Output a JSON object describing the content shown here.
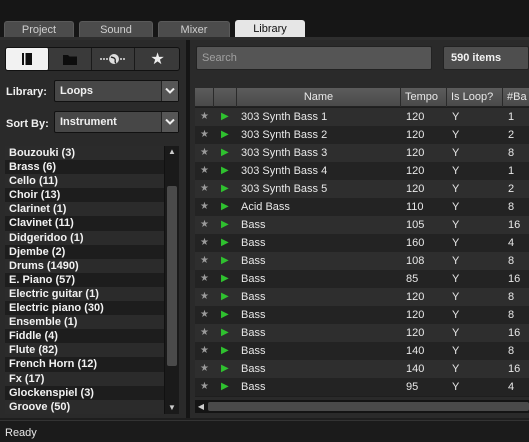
{
  "tabs": [
    {
      "label": "Project",
      "active": false
    },
    {
      "label": "Sound",
      "active": false
    },
    {
      "label": "Mixer",
      "active": false
    },
    {
      "label": "Library",
      "active": true
    }
  ],
  "left": {
    "icon_buttons": [
      "book-icon",
      "folder-icon",
      "network-icon",
      "star-icon"
    ],
    "library_label": "Library:",
    "library_value": "Loops",
    "sortby_label": "Sort By:",
    "sortby_value": "Instrument",
    "instruments": [
      "Bouzouki (3)",
      "Brass (6)",
      "Cello (11)",
      "Choir (13)",
      "Clarinet (1)",
      "Clavinet (11)",
      "Didgeridoo (1)",
      "Djembe (2)",
      "Drums (1490)",
      "E. Piano (57)",
      "Electric guitar (1)",
      "Electric piano (30)",
      "Ensemble (1)",
      "Fiddle (4)",
      "Flute (82)",
      "French Horn (12)",
      "Fx (17)",
      "Glockenspiel (3)",
      "Groove (50)"
    ]
  },
  "right": {
    "search_placeholder": "Search",
    "item_count": "590 items",
    "columns": [
      "Name",
      "Tempo",
      "Is Loop?",
      "#Ba"
    ],
    "rows": [
      [
        "303 Synth Bass 1",
        "120",
        "Y",
        "1"
      ],
      [
        "303 Synth Bass 2",
        "120",
        "Y",
        "2"
      ],
      [
        "303 Synth Bass 3",
        "120",
        "Y",
        "8"
      ],
      [
        "303 Synth Bass 4",
        "120",
        "Y",
        "1"
      ],
      [
        "303 Synth Bass 5",
        "120",
        "Y",
        "2"
      ],
      [
        "Acid Bass",
        "110",
        "Y",
        "8"
      ],
      [
        "Bass",
        "105",
        "Y",
        "16"
      ],
      [
        "Bass",
        "160",
        "Y",
        "4"
      ],
      [
        "Bass",
        "108",
        "Y",
        "8"
      ],
      [
        "Bass",
        "85",
        "Y",
        "16"
      ],
      [
        "Bass",
        "120",
        "Y",
        "8"
      ],
      [
        "Bass",
        "120",
        "Y",
        "8"
      ],
      [
        "Bass",
        "120",
        "Y",
        "16"
      ],
      [
        "Bass",
        "140",
        "Y",
        "8"
      ],
      [
        "Bass",
        "140",
        "Y",
        "16"
      ],
      [
        "Bass",
        "95",
        "Y",
        "4"
      ]
    ]
  },
  "status": "Ready",
  "colors": {
    "play": "#2fc12f",
    "active_tab": "#e6e6e6"
  }
}
